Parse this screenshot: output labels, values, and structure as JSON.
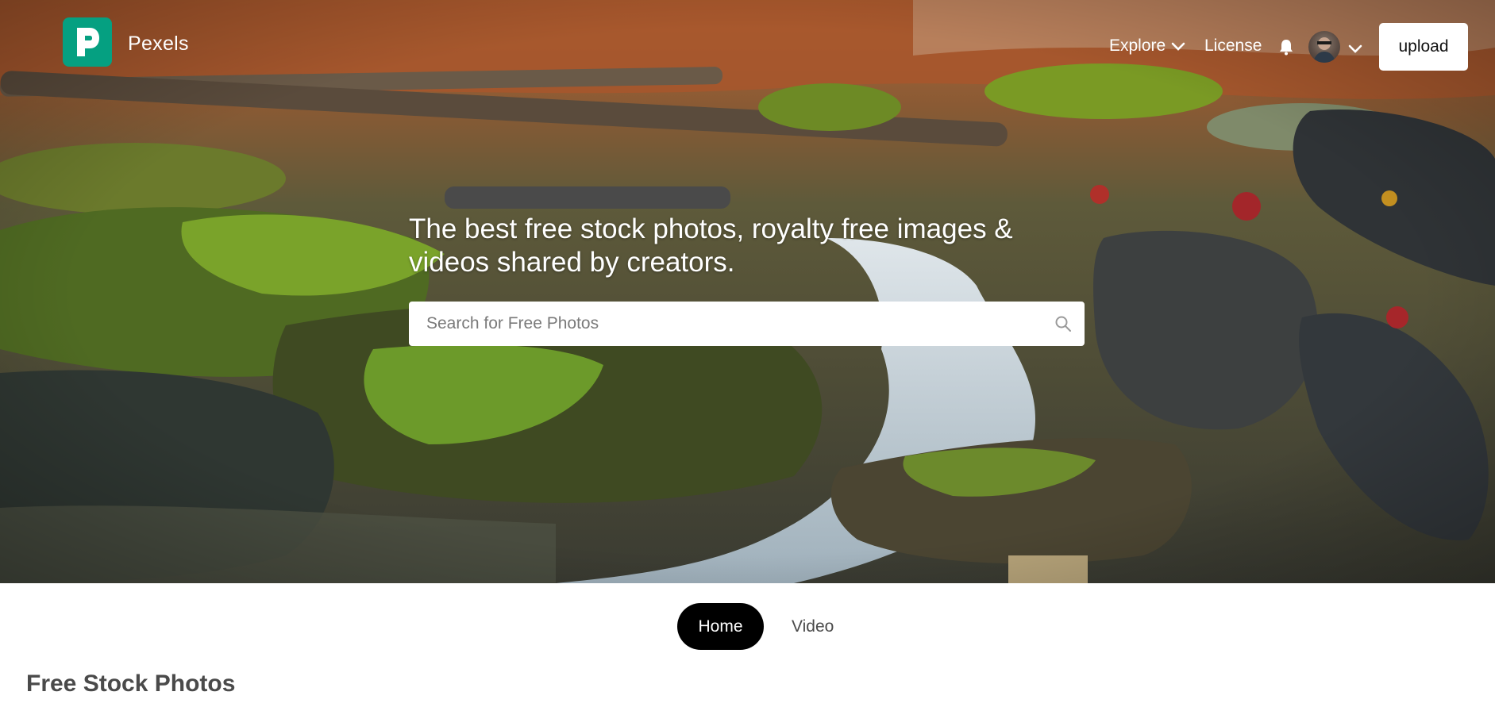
{
  "header": {
    "logo_text": "Pexels",
    "nav": {
      "explore_label": "Explore",
      "license_label": "License"
    },
    "upload_label": "upload",
    "icons": {
      "logo": "pexels-logo-icon",
      "explore_caret": "chevron-down-icon",
      "notifications": "bell-icon",
      "avatar": "user-avatar",
      "avatar_caret": "chevron-down-icon"
    }
  },
  "hero": {
    "headline": "The best free stock photos, royalty free images & videos shared by creators.",
    "search": {
      "placeholder": "Search for Free Photos",
      "value": "",
      "icon": "search-icon"
    },
    "background": "forest stream with mossy rocks"
  },
  "tabs": {
    "items": [
      {
        "label": "Home",
        "active": true
      },
      {
        "label": "Video",
        "active": false
      }
    ]
  },
  "main": {
    "section_title": "Free Stock Photos"
  },
  "colors": {
    "brand": "#05a081",
    "active_tab_bg": "#000000",
    "text_muted": "#4a4a4a"
  }
}
